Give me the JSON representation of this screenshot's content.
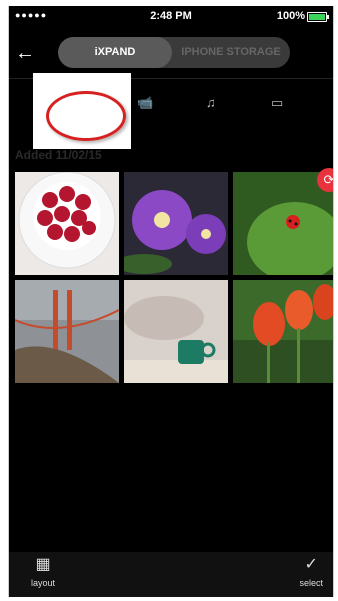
{
  "status": {
    "signal": "●●●●● ",
    "time": "2:48 PM",
    "battery": "100%",
    "battery_level": 1.0
  },
  "header": {
    "back_icon": "←",
    "tabs": [
      {
        "label": "iXPAND",
        "active": true
      },
      {
        "label": "IPHONE STORAGE",
        "active": false
      }
    ]
  },
  "filters": [
    {
      "icon": "video-camera-icon",
      "glyph": "📹"
    },
    {
      "icon": "music-note-icon",
      "glyph": "♫"
    },
    {
      "icon": "folder-icon",
      "glyph": "▭"
    }
  ],
  "group": {
    "date_label": "Added 11/02/15"
  },
  "fab": {
    "icon": "refresh-icon",
    "glyph": "⟳"
  },
  "photos": [
    {
      "name": "raspberries",
      "bg": "#e8e6e4",
      "accent": "#b4162f"
    },
    {
      "name": "purple-flowers",
      "bg": "#2b2935",
      "accent": "#8b49c5"
    },
    {
      "name": "ladybug-leaf",
      "bg": "#3f7d2c",
      "accent": "#d61f1f"
    },
    {
      "name": "golden-gate-bridge",
      "bg": "#8e9297",
      "accent": "#c44b2b"
    },
    {
      "name": "coffee-cup",
      "bg": "#d9d2cc",
      "accent": "#1d7a63"
    },
    {
      "name": "tulips",
      "bg": "#3b6a2a",
      "accent": "#e24b24"
    }
  ],
  "bottom": {
    "layout_label": "layout",
    "select_label": "select"
  }
}
